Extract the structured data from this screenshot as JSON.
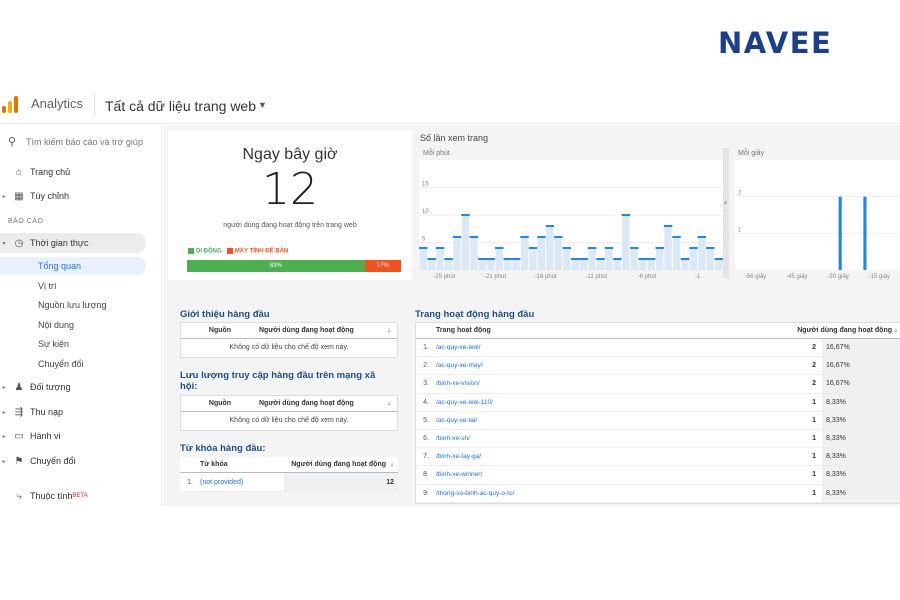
{
  "brand": "NAVEE",
  "header": {
    "app_name": "Analytics",
    "property": "Tất cả dữ liệu trang web"
  },
  "sidebar": {
    "search_placeholder": "Tìm kiếm báo cáo và trợ giúp",
    "items": [
      {
        "label": "Trang chủ",
        "icon": "home-icon"
      },
      {
        "label": "Tùy chỉnh",
        "icon": "dashboard-icon"
      }
    ],
    "section_label": "BÁO CÁO",
    "realtime": {
      "label": "Thời gian thực",
      "icon": "clock-icon"
    },
    "realtime_subitems": [
      "Tổng quan",
      "Vị trí",
      "Nguồn lưu lượng",
      "Nội dung",
      "Sự kiện",
      "Chuyển đổi"
    ],
    "reports": [
      {
        "label": "Đối tượng",
        "icon": "person-icon"
      },
      {
        "label": "Thu nạp",
        "icon": "acquisition-icon"
      },
      {
        "label": "Hành vi",
        "icon": "behavior-icon"
      },
      {
        "label": "Chuyển đổi",
        "icon": "flag-icon"
      }
    ],
    "attribution": {
      "label": "Thuộc tính",
      "badge": "BETA",
      "icon": "attribution-icon"
    }
  },
  "now": {
    "title": "Ngay bây giờ",
    "count": "12",
    "description": "người dùng đang hoạt động trên trang web",
    "legend_mobile": "DI ĐỘNG",
    "legend_desktop": "MÁY TÍNH ĐỂ BÀN",
    "mobile_pct": "83%",
    "desktop_pct": "17%",
    "mobile_share": 0.83,
    "colors": {
      "mobile": "#4caf50",
      "desktop": "#f4511e"
    }
  },
  "pageviews_panel": {
    "title": "Số lần xem trang",
    "per_minute_label": "Mỗi phút",
    "per_second_label": "Mỗi giây"
  },
  "chart_data": [
    {
      "type": "bar",
      "title": "Mỗi phút",
      "x_labels": [
        "-25 phút",
        "-21 phút",
        "-16 phút",
        "-11 phút",
        "-6 phút",
        "-1"
      ],
      "y_ticks": [
        5,
        10,
        15
      ],
      "ylim": [
        0,
        20
      ],
      "values": [
        4,
        2,
        4,
        2,
        6,
        10,
        6,
        2,
        2,
        4,
        2,
        2,
        6,
        4,
        6,
        8,
        6,
        4,
        2,
        2,
        4,
        2,
        4,
        2,
        10,
        4,
        2,
        2,
        4,
        8,
        6,
        2,
        4,
        6,
        4,
        2
      ]
    },
    {
      "type": "bar",
      "title": "Mỗi giây",
      "x_labels": [
        "-56 giây",
        "-45 giây",
        "-30 giây",
        "-15 giây"
      ],
      "y_ticks": [
        1,
        2
      ],
      "ylim": [
        0,
        3
      ],
      "values": [
        0,
        0,
        0,
        0,
        0,
        0,
        0,
        0,
        0,
        0,
        0,
        0,
        0,
        0,
        0,
        0,
        0,
        0,
        0,
        0,
        0,
        0,
        0,
        0,
        0,
        2,
        0,
        0,
        0,
        0,
        0,
        2,
        0,
        0,
        0,
        0,
        0,
        0,
        0,
        0
      ]
    }
  ],
  "referrals": {
    "title": "Giới thiệu hàng đầu",
    "col_source": "Nguồn",
    "col_users": "Người dùng đang hoạt động",
    "empty": "Không có dữ liệu cho chế độ xem này."
  },
  "social": {
    "title": "Lưu lượng truy cập hàng đầu trên mạng xã hội:",
    "col_source": "Nguồn",
    "col_users": "Người dùng đang hoạt động",
    "empty": "Không có dữ liệu cho chế độ xem này."
  },
  "keywords": {
    "title": "Từ khóa hàng đầu:",
    "col_keyword": "Từ khóa",
    "col_users": "Người dùng đang hoạt động",
    "rows": [
      {
        "idx": "1.",
        "keyword": "(not provided)",
        "users": "12"
      }
    ]
  },
  "top_pages": {
    "title": "Trang hoạt động hàng đầu",
    "col_page": "Trang hoạt động",
    "col_users": "Người dùng đang hoạt động",
    "rows": [
      {
        "idx": "1.",
        "page": "/ac-quy-xe-leoi/",
        "count": "2",
        "pct": "16,67%"
      },
      {
        "idx": "2.",
        "page": "/ac-quy-xe-may/",
        "count": "2",
        "pct": "16,67%"
      },
      {
        "idx": "3.",
        "page": "/binh-xe-vision/",
        "count": "2",
        "pct": "16,67%"
      },
      {
        "idx": "4.",
        "page": "/ac-quy-xe-leoi-110/",
        "count": "1",
        "pct": "8,33%"
      },
      {
        "idx": "5.",
        "page": "/ac-quy-xe-tai/",
        "count": "1",
        "pct": "8,33%"
      },
      {
        "idx": "6.",
        "page": "/binh-xe-sh/",
        "count": "1",
        "pct": "8,33%"
      },
      {
        "idx": "7.",
        "page": "/binh-xe-tay-ga/",
        "count": "1",
        "pct": "8,33%"
      },
      {
        "idx": "8.",
        "page": "/binh-xe-winner/",
        "count": "1",
        "pct": "8,33%"
      },
      {
        "idx": "9.",
        "page": "/thong-so-binh-ac-quy-o-to/",
        "count": "1",
        "pct": "8,33%"
      }
    ]
  }
}
